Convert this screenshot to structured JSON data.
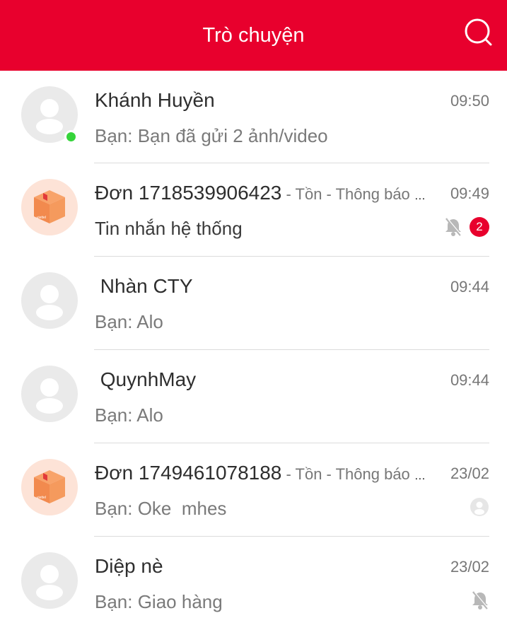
{
  "header": {
    "title": "Trò chuyện",
    "search_icon": "search-icon"
  },
  "conversations": [
    {
      "name": "Khánh Huyền",
      "subtitle": "",
      "time": "09:50",
      "preview": "Bạn: Bạn đã gửi 2 ảnh/video",
      "avatar": "default-avatar",
      "online": true
    },
    {
      "name": "Đơn 1718539906423",
      "subtitle": " - Tồn - Thông báo về đơn hàng",
      "time": "09:49",
      "preview": "Tin nhắn hệ thống",
      "avatar": "package-avatar",
      "muted": true,
      "unread": "2"
    },
    {
      "name": " Nhàn CTY",
      "subtitle": "",
      "time": "09:44",
      "preview": "Bạn: Alo",
      "avatar": "default-avatar"
    },
    {
      "name": " QuynhMay",
      "subtitle": "",
      "time": "09:44",
      "preview": "Bạn: Alo",
      "avatar": "default-avatar"
    },
    {
      "name": "Đơn 1749461078188",
      "subtitle": " - Tồn - Thông báo về đơn hàng",
      "time": "23/02",
      "preview": "Bạn: Oke  mhes",
      "avatar": "package-avatar",
      "read_receipt": true
    },
    {
      "name": "Diệp nè",
      "subtitle": "",
      "time": "23/02",
      "preview": "Bạn: Giao hàng",
      "avatar": "default-avatar",
      "muted": true
    }
  ],
  "colors": {
    "accent": "#e8002d",
    "online": "#35d43a"
  }
}
